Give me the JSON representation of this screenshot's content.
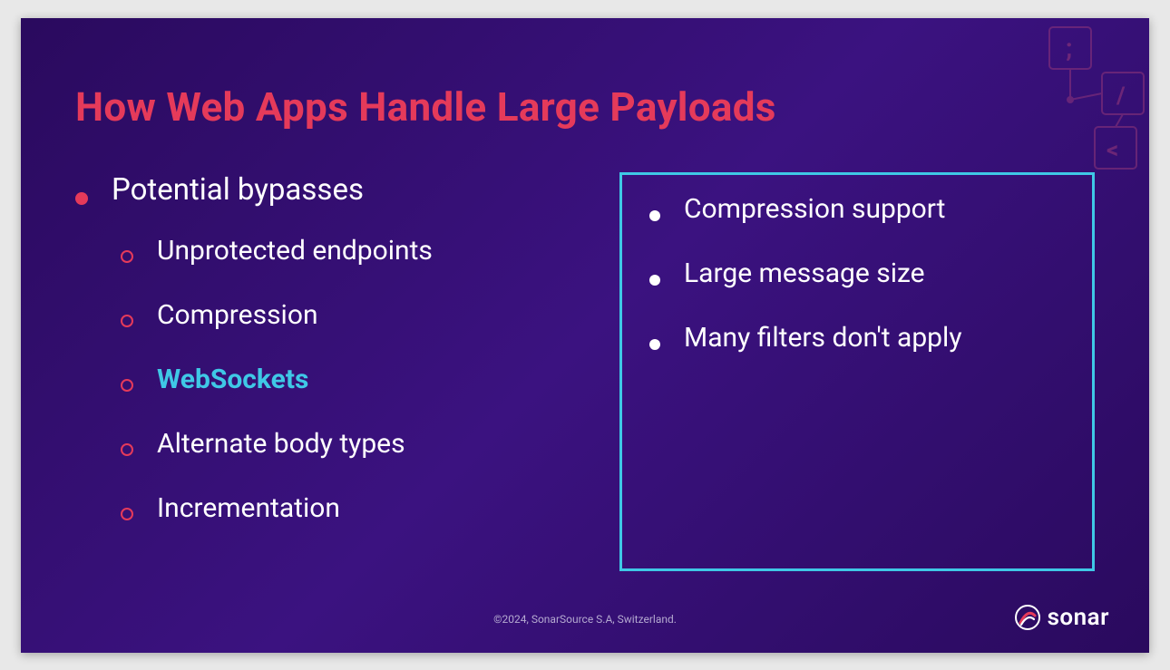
{
  "title": "How Web Apps Handle Large Payloads",
  "left": {
    "heading": "Potential bypasses",
    "items": [
      {
        "text": "Unprotected endpoints",
        "highlight": false
      },
      {
        "text": "Compression",
        "highlight": false
      },
      {
        "text": "WebSockets",
        "highlight": true
      },
      {
        "text": "Alternate body types",
        "highlight": false
      },
      {
        "text": "Incrementation",
        "highlight": false
      }
    ]
  },
  "right": {
    "items": [
      "Compression support",
      "Large message size",
      "Many filters don't apply"
    ]
  },
  "footer": {
    "copyright": "©2024, SonarSource S.A, Switzerland.",
    "brand": "sonar"
  }
}
